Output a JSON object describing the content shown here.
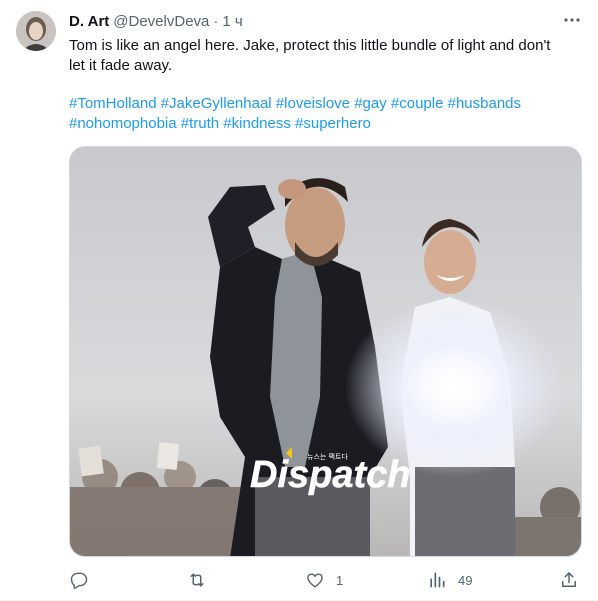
{
  "author": {
    "name": "D. Art",
    "handle": "@DevelvDeva",
    "separator": "·",
    "time": "1 ч"
  },
  "tweet": {
    "text_lines": [
      "Tom is like an angel here. Jake, protect this little bundle of light and don't",
      "let it fade away."
    ],
    "hashtag_lines": [
      [
        "#TomHolland",
        "#JakeGyllenhaal",
        "#loveislove",
        "#gay",
        "#couple",
        "#husbands"
      ],
      [
        "#nohomophobia",
        "#truth",
        "#kindness",
        "#superhero"
      ]
    ]
  },
  "media": {
    "watermark": "Dispatch",
    "watermark_sub": "뉴스는 팩트다"
  },
  "actions": {
    "reply_count": "",
    "retweet_count": "",
    "like_count": "1",
    "views_count": "49"
  },
  "colors": {
    "link": "#1d9bf0",
    "muted": "#536471",
    "text": "#0f1419",
    "border": "#cfd9de"
  },
  "icons": [
    "more-icon",
    "reply-icon",
    "retweet-icon",
    "like-icon",
    "views-icon",
    "share-icon"
  ]
}
